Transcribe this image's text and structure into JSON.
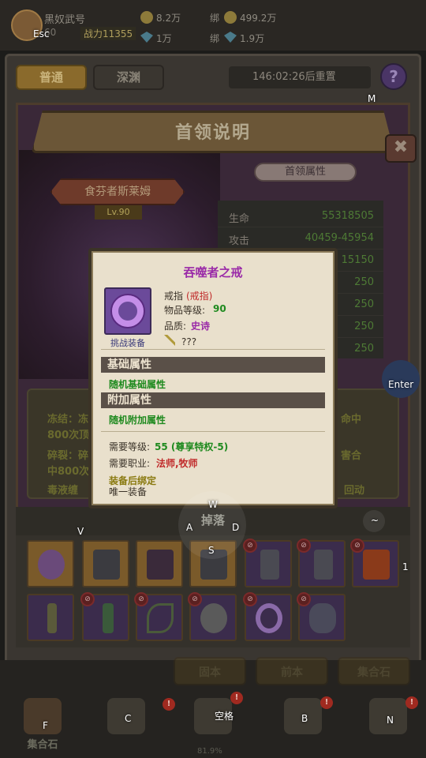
{
  "player": {
    "name": "黑奴武号",
    "level": "60",
    "battle": "战力11355"
  },
  "resources": {
    "gold": "8.2万",
    "bound_gold": "499.2万",
    "bound_label": "绑",
    "gems": "1万",
    "bound_gems": "1.9万",
    "bound_label2": "绑"
  },
  "tabs": {
    "normal": "普通",
    "abyss": "深渊"
  },
  "timer": "146:02:26后重置",
  "help": "?",
  "boss_panel": {
    "title": "首领说明",
    "close": "✖",
    "boss_name": "食芬者斯莱姆",
    "boss_level": "Lv.90",
    "attr_tag": "首领属性",
    "stats": [
      {
        "label": "生命",
        "value": "55318505"
      },
      {
        "label": "攻击",
        "value": "40459-45954"
      },
      {
        "label": "",
        "value": "15150"
      },
      {
        "label": "",
        "value": "250"
      },
      {
        "label": "",
        "value": "250"
      },
      {
        "label": "",
        "value": "250"
      },
      {
        "label": "",
        "value": "250"
      }
    ],
    "skills": [
      {
        "left": "冻结：冻",
        "right": "命中"
      },
      {
        "left": "800次顶",
        "right": ""
      },
      {
        "left": "碎裂：碎",
        "right": "害合"
      },
      {
        "left": "中800次",
        "right": ""
      },
      {
        "left": "毒液缠",
        "right": "回动"
      }
    ]
  },
  "drops": {
    "label": "掉落"
  },
  "tooltip": {
    "title": "吞噬者之戒",
    "challenge_label": "挑战装备",
    "slot_label": "戒指",
    "slot_value": "(戒指)",
    "item_level_label": "物品等级:",
    "item_level": "90",
    "quality_label": "品质:",
    "quality": "史诗",
    "unknown": "???",
    "base_header": "基础属性",
    "base_random": "随机基础属性",
    "extra_header": "附加属性",
    "extra_random": "随机附加属性",
    "req_level_label": "需要等级:",
    "req_level": "55 (尊享特权-5)",
    "req_class_label": "需要职业:",
    "req_class": "法师,牧师",
    "bind_text": "装备后绑定",
    "unique_text": "唯一装备"
  },
  "bottom_nav": {
    "buttons": [
      "固本",
      "前本",
      "集合石"
    ],
    "items": [
      {
        "label": "集合石",
        "badge": ""
      },
      {
        "label": "",
        "badge": "!"
      },
      {
        "label": "",
        "badge": "!"
      },
      {
        "label": "",
        "badge": "!"
      },
      {
        "label": "",
        "badge": "!"
      }
    ],
    "progress": "81.9%"
  },
  "key_hints": {
    "esc": "Esc",
    "m": "M",
    "enter": "Enter",
    "w": "W",
    "a": "A",
    "s": "S",
    "d": "D",
    "v": "V",
    "tilde": "~",
    "one": "1",
    "f": "F",
    "c": "C",
    "space": "空格",
    "b": "B",
    "n": "N"
  }
}
